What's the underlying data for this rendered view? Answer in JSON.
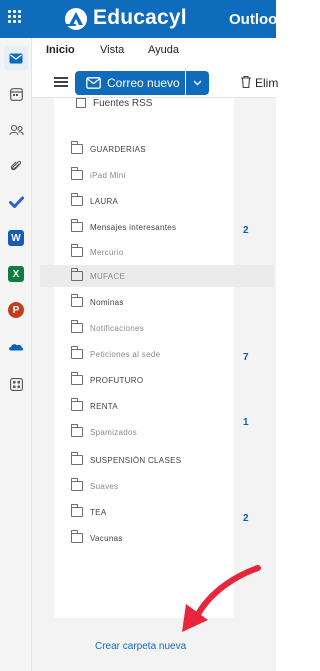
{
  "header": {
    "brand": "Educacyl",
    "app_name": "Outlook"
  },
  "tabs": [
    {
      "label": "Inicio"
    },
    {
      "label": "Vista"
    },
    {
      "label": "Ayuda"
    }
  ],
  "ribbon": {
    "new_mail_label": "Correo nuevo",
    "delete_label": "Elim"
  },
  "rail_icons": [
    "mail-icon",
    "calendar-icon",
    "people-icon",
    "attach-icon",
    "todo-icon",
    "word-icon",
    "excel-icon",
    "powerpoint-icon",
    "onedrive-icon",
    "more-apps-icon"
  ],
  "colors": {
    "accent": "#0f6cbd",
    "word": "#185abd",
    "excel": "#107c41",
    "powerpoint": "#c43e1c",
    "onedrive": "#0364b8",
    "todo": "#2564cf"
  },
  "folders": {
    "rss": "Fuentes RSS",
    "items": [
      {
        "label": "GUARDERIAS"
      },
      {
        "label": "iPad Mini"
      },
      {
        "label": "LAURA"
      },
      {
        "label": "Mensajes interesantes"
      },
      {
        "label": "Mercurio"
      },
      {
        "label": "MUFACE"
      },
      {
        "label": "Nominas"
      },
      {
        "label": "Notificaciones"
      },
      {
        "label": "Peticiones al sede"
      },
      {
        "label": "PROFUTURO"
      },
      {
        "label": "RENTA"
      },
      {
        "label": "Spamizados"
      },
      {
        "label": "SUSPENSIÓN CLASES"
      },
      {
        "label": "Suaves"
      },
      {
        "label": "TEA"
      },
      {
        "label": "Vacunas"
      }
    ],
    "counts": [
      "2",
      "7",
      "1",
      "2"
    ],
    "create_label": "Crear carpeta nueva"
  }
}
